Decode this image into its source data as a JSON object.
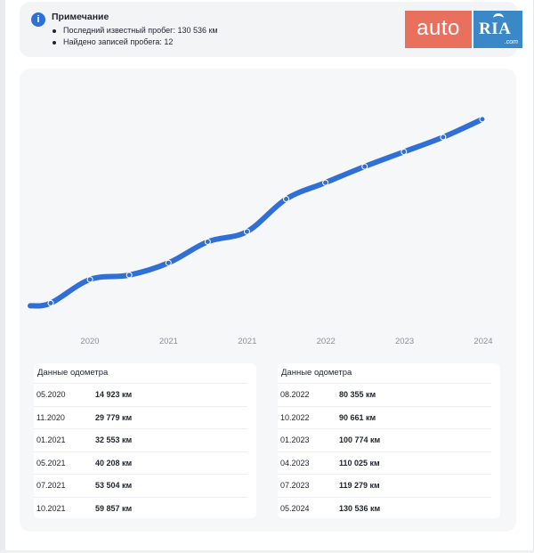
{
  "note": {
    "title": "Примечание",
    "items": [
      "Последний известный пробег: 130 536 км",
      "Найдено записей пробега: 12"
    ]
  },
  "logo": {
    "left": "auto",
    "right": "RIA",
    "suffix": ".com"
  },
  "chart_data": {
    "type": "line",
    "x": [
      "05.2020",
      "11.2020",
      "01.2021",
      "05.2021",
      "07.2021",
      "10.2021",
      "08.2022",
      "10.2022",
      "01.2023",
      "04.2023",
      "07.2023",
      "05.2024"
    ],
    "series": [
      {
        "values": [
          14923,
          29779,
          32553,
          40208,
          53504,
          59857,
          80355,
          90661,
          100774,
          110025,
          119279,
          130536
        ]
      }
    ],
    "x_tick_labels": [
      "2020",
      "2021",
      "2021",
      "2022",
      "2023",
      "2024"
    ],
    "ylim": [
      0,
      140000
    ],
    "grid": false,
    "legend": "none",
    "line_color": "#2f6fd6"
  },
  "tables": [
    {
      "title": "Данные одометра",
      "rows": [
        {
          "date": "05.2020",
          "value": "14 923 км"
        },
        {
          "date": "11.2020",
          "value": "29 779 км"
        },
        {
          "date": "01.2021",
          "value": "32 553 км"
        },
        {
          "date": "05.2021",
          "value": "40 208 км"
        },
        {
          "date": "07.2021",
          "value": "53 504 км"
        },
        {
          "date": "10.2021",
          "value": "59 857 км"
        }
      ]
    },
    {
      "title": "Данные одометра",
      "rows": [
        {
          "date": "08.2022",
          "value": "80 355 км"
        },
        {
          "date": "10.2022",
          "value": "90 661 км"
        },
        {
          "date": "01.2023",
          "value": "100 774 км"
        },
        {
          "date": "04.2023",
          "value": "110 025 км"
        },
        {
          "date": "07.2023",
          "value": "119 279 км"
        },
        {
          "date": "05.2024",
          "value": "130 536 км"
        }
      ]
    }
  ]
}
